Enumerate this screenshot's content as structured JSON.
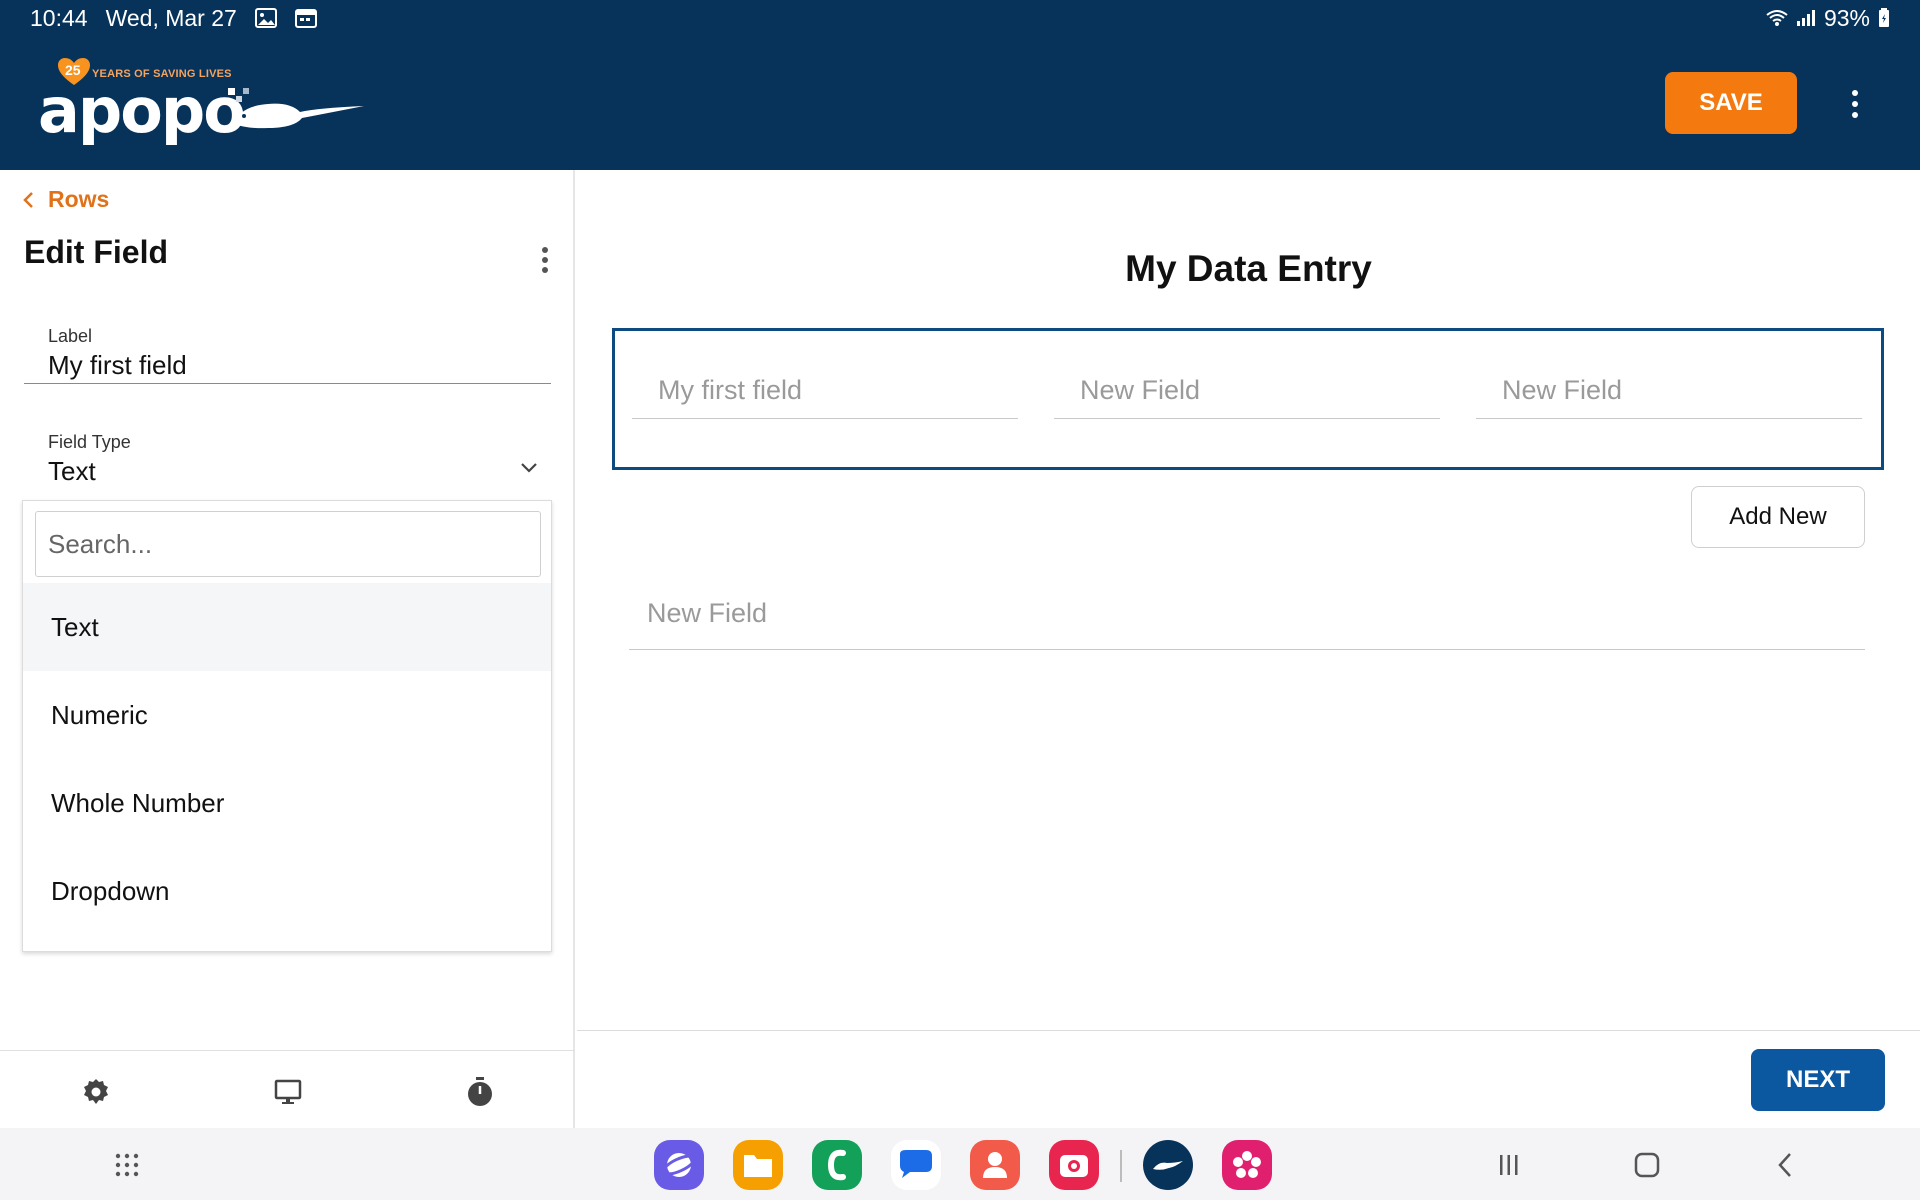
{
  "status_bar": {
    "time": "10:44",
    "date": "Wed, Mar 27",
    "battery": "93%",
    "icons": [
      "gallery-icon",
      "calendar-icon",
      "wifi-icon",
      "signal-icon",
      "battery-icon"
    ]
  },
  "header": {
    "logo_text": "apopo",
    "logo_badge": "25",
    "logo_tagline": "YEARS OF SAVING LIVES",
    "save_label": "SAVE",
    "bg_color": "#07335a",
    "accent_color": "#f47a10"
  },
  "left_panel": {
    "back_label": "Rows",
    "title": "Edit Field",
    "label_field": {
      "label": "Label",
      "value": "My first field"
    },
    "type_field": {
      "label": "Field Type",
      "value": "Text"
    },
    "dropdown": {
      "search_placeholder": "Search...",
      "options": [
        "Text",
        "Numeric",
        "Whole Number",
        "Dropdown"
      ],
      "selected": "Text"
    },
    "toolbar_icons": [
      "gear-icon",
      "monitor-icon",
      "timer-icon"
    ]
  },
  "main": {
    "title": "My Data Entry",
    "row_fields": [
      "My first field",
      "New Field",
      "New Field"
    ],
    "add_new_label": "Add New",
    "single_field": "New Field",
    "next_label": "NEXT",
    "next_color": "#0b57a0"
  },
  "navbar": {
    "apps": [
      "internet-app-icon",
      "files-app-icon",
      "phone-app-icon",
      "messages-app-icon",
      "contacts-app-icon",
      "camera-app-icon",
      "apopo-app-icon",
      "flower-app-icon"
    ]
  }
}
